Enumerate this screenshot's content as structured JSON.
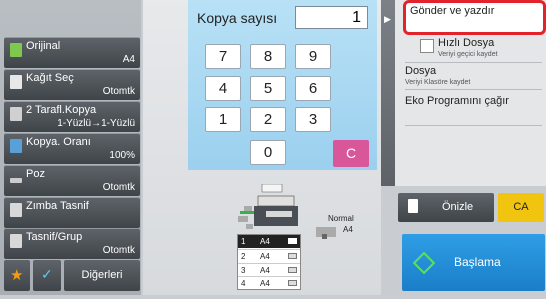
{
  "left_menu": [
    {
      "label": "Orijinal",
      "value": "A4",
      "icon_color": "#7ec850"
    },
    {
      "label": "Kağıt Seç",
      "value": "Otomtk",
      "icon_color": "#e8e8e8"
    },
    {
      "label": "2 Tarafl.Kopya",
      "value": "1-Yüzlü→1-Yüzlü",
      "icon_color": "#d0d0d0"
    },
    {
      "label": "Kopya. Oranı",
      "value": "100%",
      "icon_color": "#5aa0d8"
    },
    {
      "label": "Poz",
      "value": "Otomtk",
      "icon_color": "#cccccc"
    },
    {
      "label": "Zımba Tasnif",
      "value": "",
      "icon_color": "#d8d8d8"
    },
    {
      "label": "Tasnif/Grup",
      "value": "Otomtk",
      "icon_color": "#d8d8d8"
    }
  ],
  "bottom": {
    "other_label": "Diğerleri"
  },
  "keypad": {
    "label": "Kopya sayısı",
    "value": "1",
    "keys": [
      "7",
      "8",
      "9",
      "4",
      "5",
      "6",
      "1",
      "2",
      "3",
      "0"
    ],
    "clear_label": "C"
  },
  "preview": {
    "output_label": "Normal",
    "output_size": "A4",
    "trays": [
      {
        "num": "1",
        "size": "A4"
      },
      {
        "num": "2",
        "size": "A4"
      },
      {
        "num": "3",
        "size": "A4"
      },
      {
        "num": "4",
        "size": "A4"
      }
    ]
  },
  "right_menu": {
    "send_label": "Gönder ve yazdır",
    "quick_file_label": "Hızlı Dosya",
    "quick_file_sub": "Veriyi geçici kaydet",
    "file_label": "Dosya",
    "file_sub": "Veriyi Klasöre kaydet",
    "eco_label": "Eko Programını çağır"
  },
  "actions": {
    "preview": "Önizle",
    "ca": "CA",
    "start": "Başlama"
  }
}
